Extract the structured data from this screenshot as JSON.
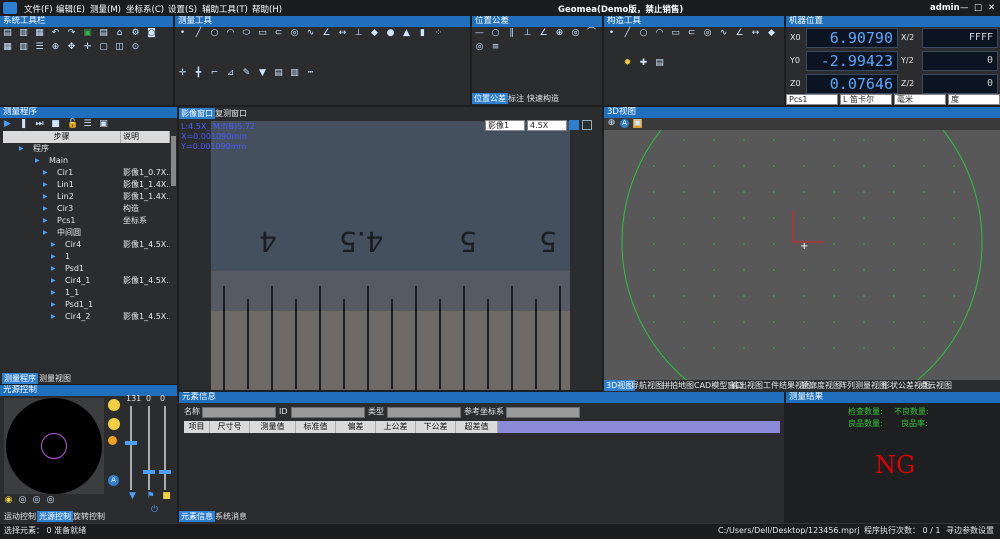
{
  "app": {
    "title": "Geomea(Demo版，禁止销售)",
    "user": "admin",
    "window_controls": [
      "—",
      "□",
      "✕"
    ]
  },
  "menu": [
    "文件(F)",
    "编辑(E)",
    "测量(M)",
    "坐标系(C)",
    "设置(S)",
    "辅助工具(T)",
    "帮助(H)"
  ],
  "panels": {
    "system_toolbar": "系统工具栏",
    "measure_tools": "测量工具",
    "position_tolerance": "位置公差",
    "construct_tools": "构造工具",
    "machine_position": "机器位置",
    "measure_program": "测量程序",
    "3d_view": "3D视图",
    "element_info": "元素信息",
    "measure_result": "测量结果",
    "light_control": "光源控制"
  },
  "position_tabs": [
    "位置公差",
    "标注",
    "快速构造"
  ],
  "machine": {
    "x": "6.90790",
    "y": "-2.99423",
    "z": "0.07646",
    "x2": "FFFF",
    "y2": "0",
    "z2": "0",
    "lx": "X0",
    "ly": "Y0",
    "lz": "Z0",
    "lx2": "X/2",
    "ly2": "Y/2",
    "lz2": "Z/2",
    "coord": "Pcs1",
    "proj": "L 笛卡尔",
    "unit": "毫米",
    "angle": "度"
  },
  "image_tabs": [
    "影像窗口",
    "复测窗口"
  ],
  "image": {
    "overlay_line1": "L:4.5X_:M:f(B)5.72",
    "overlay_line2": "X=0.001090mm",
    "overlay_line3": "Y=0.001090mm",
    "camera": "影像1",
    "zoom": "4.5X",
    "scale_labels": [
      "4",
      "4.5",
      "5",
      "5"
    ]
  },
  "program": {
    "col_step": "步骤",
    "col_desc": "说明",
    "rows": [
      {
        "label": "程序",
        "desc": ""
      },
      {
        "label": "Main",
        "desc": ""
      },
      {
        "label": "Cir1",
        "desc": "影像1_0.7X..."
      },
      {
        "label": "Lin1",
        "desc": "影像1_1.4X..."
      },
      {
        "label": "Lin2",
        "desc": "影像1_1.4X..."
      },
      {
        "label": "Cir3",
        "desc": "构造"
      },
      {
        "label": "Pcs1",
        "desc": "坐标系"
      },
      {
        "label": "中间圆",
        "desc": ""
      },
      {
        "label": "Cir4",
        "desc": "影像1_4.5X..."
      },
      {
        "label": "1",
        "desc": ""
      },
      {
        "label": "Psd1",
        "desc": ""
      },
      {
        "label": "Cir4_1",
        "desc": "影像1_4.5X..."
      },
      {
        "label": "1_1",
        "desc": ""
      },
      {
        "label": "Psd1_1",
        "desc": ""
      },
      {
        "label": "Cir4_2",
        "desc": "影像1_4.5X..."
      }
    ],
    "tabs": [
      "测量程序",
      "测量视图"
    ]
  },
  "light": {
    "values": [
      "131",
      "0",
      "0"
    ],
    "tabs": [
      "运动控制",
      "光源控制",
      "旋转控制"
    ]
  },
  "view_tabs": [
    "3D视图",
    "导航视图",
    "拼拍地图",
    "CAD模型窗口",
    "输出视图",
    "工件结果视图",
    "轮廓度视图",
    "阵列测量视图",
    "形状公差视图",
    "点云视图"
  ],
  "element": {
    "name_label": "名称",
    "id_label": "ID",
    "type_label": "类型",
    "ref_label": "参考坐标系",
    "cols": [
      "项目",
      "尺寸号",
      "测量值",
      "标准值",
      "偏差",
      "上公差",
      "下公差",
      "超差值"
    ],
    "tabs": [
      "元素信息",
      "系统消息"
    ]
  },
  "result": {
    "check_label": "检查数量:",
    "bad_label": "不良数量:",
    "good_label": "良品数量:",
    "rate_label": "良品率:",
    "verdict": "NG"
  },
  "status": {
    "select": "选择元素： 0 准备就绪",
    "path": "C:/Users/Dell/Desktop/123456.mprj",
    "exec": "程序执行次数： 0 / 1",
    "seek": "寻边参数设置"
  },
  "colors": {
    "accent": "#1f6fbd",
    "lcd": "#5aa7ff",
    "ng": "#e00000",
    "circle": "#27c43a"
  }
}
